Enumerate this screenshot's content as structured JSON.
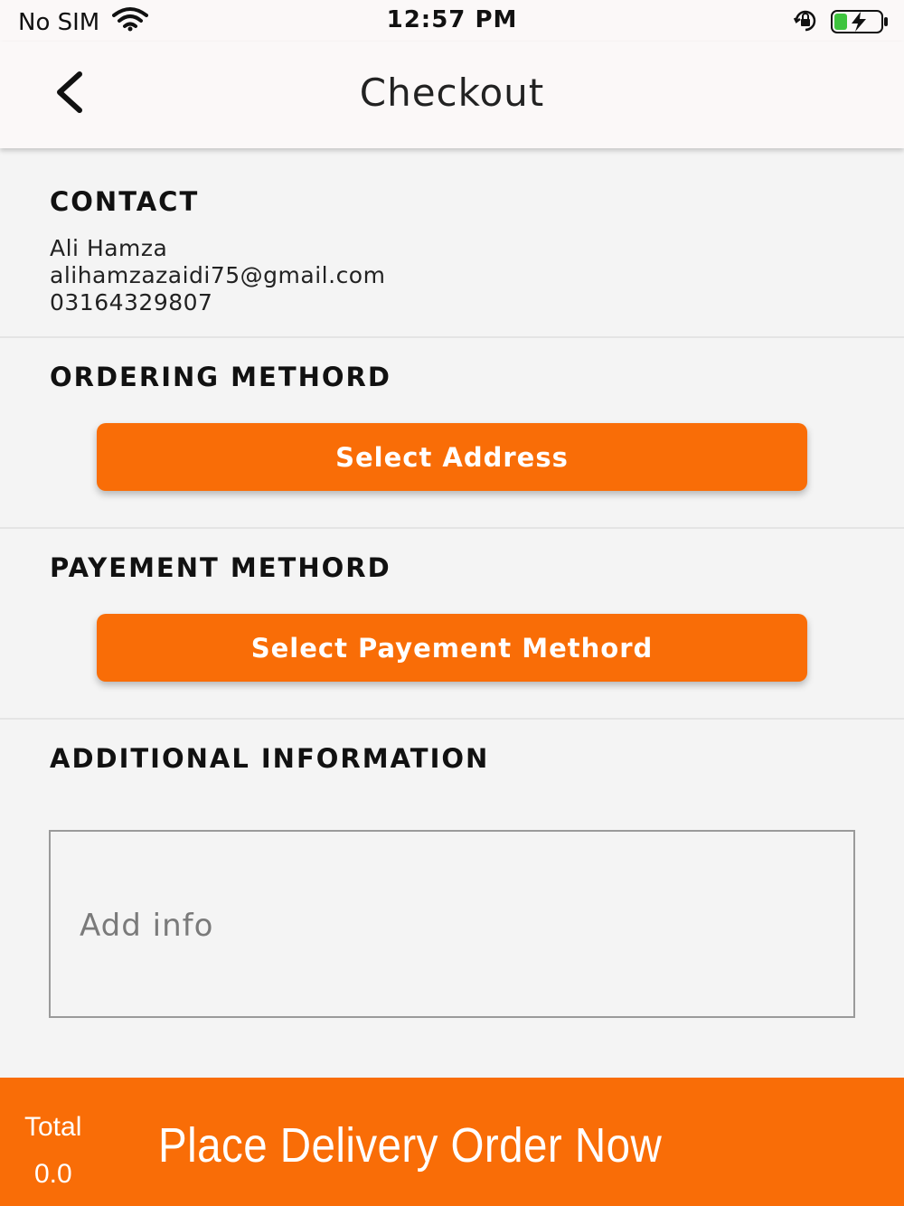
{
  "status_bar": {
    "carrier": "No SIM",
    "time": "12:57 PM",
    "icons": [
      "wifi-icon",
      "rotation-lock-icon",
      "battery-charging-icon"
    ]
  },
  "nav": {
    "title": "Checkout",
    "back_icon": "chevron-left-icon"
  },
  "contact": {
    "heading": "CONTACT",
    "name": "Ali Hamza",
    "email": "alihamzazaidi75@gmail.com",
    "phone": "03164329807"
  },
  "ordering": {
    "heading": "ORDERING METHORD",
    "button_label": "Select Address"
  },
  "payment": {
    "heading": "PAYEMENT METHORD",
    "button_label": "Select Payement Methord"
  },
  "additional": {
    "heading": "ADDITIONAL INFORMATION",
    "placeholder": "Add info"
  },
  "footer": {
    "total_label": "Total",
    "total_value": "0.0",
    "action_label": "Place Delivery Order Now"
  },
  "colors": {
    "accent": "#f96d07",
    "background": "#f4f4f4",
    "bar_background": "#fbf8f8"
  }
}
